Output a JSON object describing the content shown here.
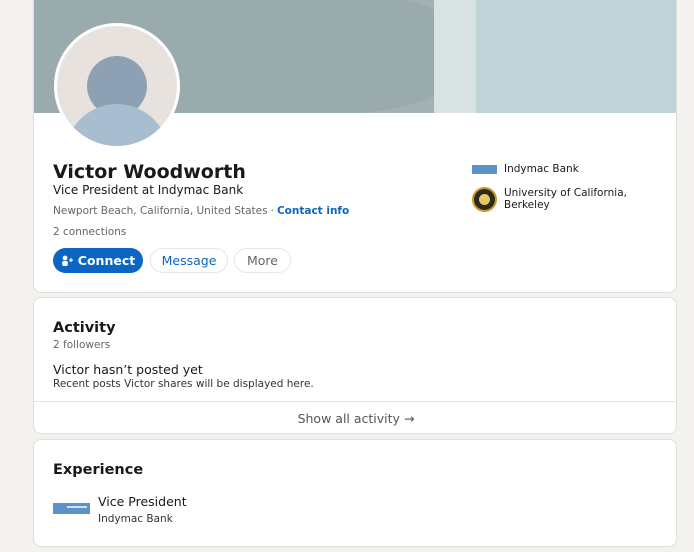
{
  "profile": {
    "name": "Victor Woodworth",
    "headline": "Vice President at Indymac Bank",
    "location": "Newport Beach, California, United States",
    "separator": "·",
    "contact_info": "Contact info",
    "connections": "2 connections",
    "buttons": {
      "connect": "Connect",
      "message": "Message",
      "more": "More"
    },
    "side": [
      {
        "label": "Indymac Bank",
        "icon": "indymac-logo"
      },
      {
        "label": "University of California, Berkeley",
        "icon": "uc-berkeley-seal"
      }
    ]
  },
  "activity": {
    "title": "Activity",
    "followers": "2 followers",
    "empty_title": "Victor hasn’t posted yet",
    "empty_sub": "Recent posts Victor shares will be displayed here.",
    "show_all": "Show all activity",
    "show_all_arrow": "→"
  },
  "experience": {
    "title": "Experience",
    "items": [
      {
        "role": "Vice President",
        "company": "Indymac Bank",
        "icon": "indymac-logo"
      }
    ]
  },
  "colors": {
    "accent": "#0a66c2",
    "background": "#f3f2ef",
    "banner": "#a1b1b4"
  }
}
